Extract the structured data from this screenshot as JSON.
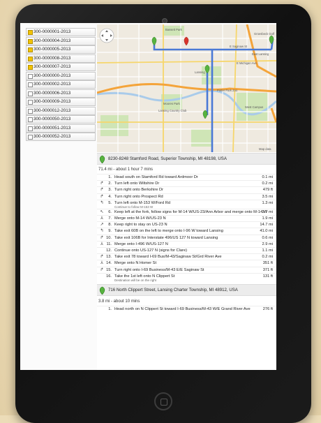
{
  "cases": [
    {
      "label": "300-0000001-2013",
      "selected": true
    },
    {
      "label": "300-0000004-2013",
      "selected": true
    },
    {
      "label": "300-0000005-2013",
      "selected": true
    },
    {
      "label": "300-0000008-2013",
      "selected": true
    },
    {
      "label": "300-0000007-2013",
      "selected": true
    },
    {
      "label": "300-0000000-2013",
      "selected": false
    },
    {
      "label": "300-0000002-2013",
      "selected": false
    },
    {
      "label": "300-0000006-2013",
      "selected": false
    },
    {
      "label": "300-0000009-2013",
      "selected": false
    },
    {
      "label": "300-0000012-2013",
      "selected": false
    },
    {
      "label": "300-0000050-2013",
      "selected": false
    },
    {
      "label": "300-0000051-2013",
      "selected": false
    },
    {
      "label": "300-0000052-2013",
      "selected": false
    }
  ],
  "map": {
    "labels": {
      "bassett_park": "Bassett Park",
      "lansing": "Lansing",
      "east_lansing": "East Lansing",
      "moores_park": "Moores Park",
      "potter_park": "Potter Park Zoo",
      "michigan_ave": "E Michigan Ave",
      "saginaw": "E Saginaw St",
      "lansing_cc": "Lansing Country Club",
      "groesbeck": "Groesbeck Golf",
      "west_campus": "West Campus",
      "map_data": "Map data"
    },
    "route_color": "#4a79d6",
    "highway_color": "#f4a43a",
    "pin_green": "#57b33f",
    "pin_red": "#d9342b"
  },
  "start": {
    "address": "8230-8248 Stamford Road, Superior Township, MI 48198, USA"
  },
  "summary1": "71.4 mi - about 1 hour 7 mins",
  "steps": [
    {
      "icon": "",
      "num": "1.",
      "text": "Head south on Stamford Rd toward Ardmoor Dr",
      "sub": "",
      "dist": "0.1 mi"
    },
    {
      "icon": "↱",
      "num": "2.",
      "text": "Turn left onto Wiltshire Dr",
      "sub": "",
      "dist": "0.2 mi"
    },
    {
      "icon": "↱",
      "num": "3.",
      "text": "Turn right onto Berkshire Dr",
      "sub": "",
      "dist": "479 ft"
    },
    {
      "icon": "↱",
      "num": "4.",
      "text": "Turn right onto Prospect Rd",
      "sub": "",
      "dist": "3.5 mi"
    },
    {
      "icon": "↰",
      "num": "5.",
      "text": "Turn left onto M-153 W/Ford Rd",
      "sub": "Continue to follow M-153 W",
      "dist": "1.3 mi"
    },
    {
      "icon": "↖",
      "num": "6.",
      "text": "Keep left at the fork, follow signs for M-14 W/US-23/Ann Arbor and merge onto M-14 W",
      "sub": "",
      "dist": "3.7 mi"
    },
    {
      "icon": "⅄",
      "num": "7.",
      "text": "Merge onto M-14 W/US-23 N",
      "sub": "",
      "dist": "1.9 mi"
    },
    {
      "icon": "↗",
      "num": "8.",
      "text": "Keep right to stay on US-23 N",
      "sub": "",
      "dist": "14.7 mi"
    },
    {
      "icon": "↰",
      "num": "9.",
      "text": "Take exit 60B on the left to merge onto I-96 W toward Lansing",
      "sub": "",
      "dist": "41.0 mi"
    },
    {
      "icon": "↱",
      "num": "10.",
      "text": "Take exit 106B for Interstate 496/US 127 N toward Lansing",
      "sub": "",
      "dist": "0.6 mi"
    },
    {
      "icon": "⅄",
      "num": "11.",
      "text": "Merge onto I-496 W/US-127 N",
      "sub": "",
      "dist": "2.9 mi"
    },
    {
      "icon": "",
      "num": "12.",
      "text": "Continue onto US-127 N (signs for Clare)",
      "sub": "",
      "dist": "1.1 mi"
    },
    {
      "icon": "↱",
      "num": "13.",
      "text": "Take exit 78 toward I-69 Bus/M-43/Saginaw St/Grd River Ave",
      "sub": "",
      "dist": "0.2 mi"
    },
    {
      "icon": "⅄",
      "num": "14.",
      "text": "Merge onto N Homer St",
      "sub": "",
      "dist": "351 ft"
    },
    {
      "icon": "↱",
      "num": "15.",
      "text": "Turn right onto I-69 Business/M-43 E/E Saginaw St",
      "sub": "",
      "dist": "371 ft"
    },
    {
      "icon": "",
      "num": "16.",
      "text": "Take the 1st left onto N Clippert St",
      "sub": "Destination will be on the right",
      "dist": "131 ft"
    }
  ],
  "mid": {
    "address": "716 North Clippert Street, Lansing Charter Township, MI 48912, USA"
  },
  "summary2": "3.8 mi - about 10 mins",
  "steps2": [
    {
      "icon": "",
      "num": "1.",
      "text": "Head north on N Clippert St toward I-69 Business/M-43 W/E Grand River Ave",
      "sub": "",
      "dist": "276 ft"
    }
  ]
}
